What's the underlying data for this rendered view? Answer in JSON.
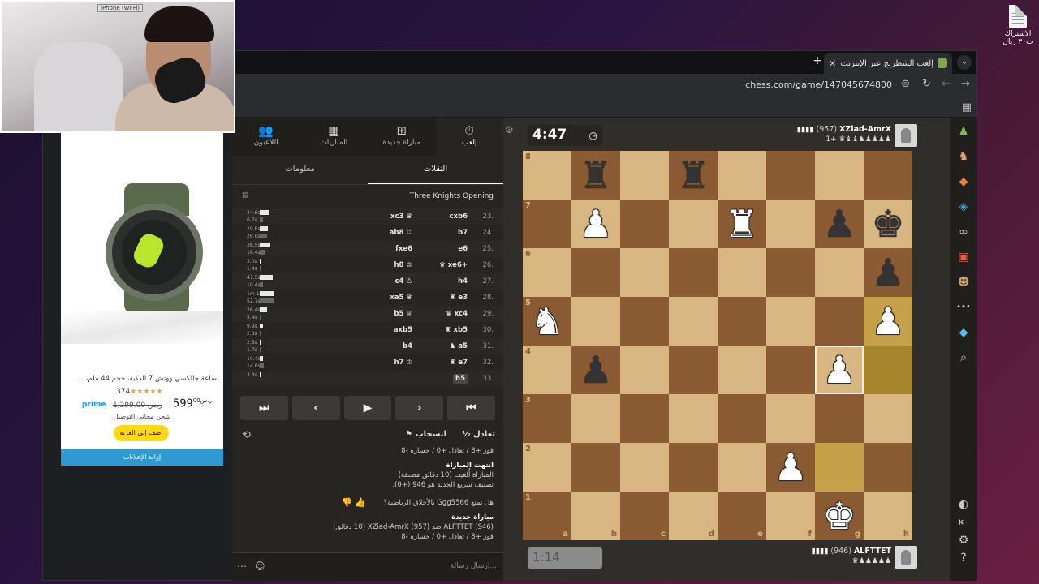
{
  "desktop": {
    "file_label": "الاشتراك ب٣٠ ريال"
  },
  "webcam": {
    "label": "iPhone (Wi-Fi)"
  },
  "browser": {
    "tab_title": "إلعب الشطرنج عبر الإنترنت مجاناً",
    "url": "chess.com/game/147045674800"
  },
  "ad": {
    "title": "ساعة جالكسي ووتش 7 الذكية، حجم 44 ملم، ...",
    "rating_count": "374",
    "stars": "★★★★★",
    "prime": "prime",
    "old_price": "ر.س 1,299.00",
    "price_main": "599",
    "price_frac": "00",
    "price_currency": "ر.س",
    "shipping": "شحن مجاني التوصيل",
    "cart_button": "أضف إلى العربة",
    "remove_ads": "إزالة الإعلانات"
  },
  "panel": {
    "tabs": [
      {
        "label": "إلعب",
        "icon": "⏱"
      },
      {
        "label": "مباراة جديدة",
        "icon": "⊞"
      },
      {
        "label": "المباريات",
        "icon": "▦"
      },
      {
        "label": "اللاعبون",
        "icon": "👥"
      }
    ],
    "subtabs": [
      "النقلات",
      "معلومات"
    ],
    "opening": "Three Knights Opening",
    "moves": [
      {
        "n": "23.",
        "w": "cxb6",
        "b": "xc3 ♛",
        "t1": "34.6s",
        "t2": "6.7s",
        "p1": 12,
        "p2": 4
      },
      {
        "n": "24.",
        "w": "b7",
        "b": "ab8 ♖",
        "t1": "29.8s",
        "t2": "26.6s",
        "p1": 10,
        "p2": 9
      },
      {
        "n": "25.",
        "w": "e6",
        "b": "fxe6",
        "t1": "38.5s",
        "t2": "18.4s",
        "p1": 13,
        "p2": 6
      },
      {
        "n": "26.",
        "w": "♛ xe6+",
        "b": "h8 ♔",
        "t1": "3.0s",
        "t2": "1.4s",
        "p1": 2,
        "p2": 1
      },
      {
        "n": "27.",
        "w": "h4",
        "b": "c4 ♙",
        "t1": "47.5s",
        "t2": "10.4s",
        "p1": 16,
        "p2": 4
      },
      {
        "n": "28.",
        "w": "♜ e3",
        "b": "xa5 ♛",
        "t1": "1m 1s",
        "t2": "52.7s",
        "p1": 18,
        "p2": 17
      },
      {
        "n": "29.",
        "w": "♛ xc4",
        "b": "b5 ♕",
        "t1": "26.4s",
        "t2": "5.4s",
        "p1": 9,
        "p2": 2
      },
      {
        "n": "30.",
        "w": "♜ xb5",
        "b": "axb5",
        "t1": "9.9s",
        "t2": "2.8s",
        "p1": 4,
        "p2": 1
      },
      {
        "n": "31.",
        "w": "♞ a5",
        "b": "b4",
        "t1": "2.8s",
        "t2": "1.7s",
        "p1": 1,
        "p2": 1
      },
      {
        "n": "32.",
        "w": "♜ e7",
        "b": "h7 ♔",
        "t1": "10.4s",
        "t2": "14.6s",
        "p1": 4,
        "p2": 5
      },
      {
        "n": "33.",
        "w": "h5",
        "b": "",
        "t1": "3.8s",
        "t2": "",
        "p1": 1,
        "p2": 0
      }
    ],
    "controls": [
      "⏮",
      "‹",
      "▶",
      "›",
      "⏭"
    ],
    "draw": "½ تعادل",
    "resign": "⚑ انسحاب",
    "flip_icon": "⟲",
    "chat": {
      "line1": "فوز +8 / تعادل +0 / خسارة -8",
      "over_title": "انتهت المباراة",
      "over_line": "المباراة أُلغيت (10 دقائق مصنفة)",
      "rating_line": "تصنيف سريع الجديد هو 946 (+0).",
      "question": "هل تمتع Ggg5566 بالأخلاق الرياضية؟",
      "new_game": "مباراة جديدة",
      "match_line": "ALFTTET (946) ضد XZiad-AmrX (957) (10 دقائق)",
      "line2": "فوز +8 / تعادل +0 / خسارة -8"
    },
    "chat_placeholder": "إرسال رسالة..."
  },
  "game": {
    "top_clock": "4:47",
    "bottom_clock": "1:14",
    "top_player": {
      "name": "XZiad-AmrX",
      "rating": "(957)",
      "captured": "1+ ♛♝♝♞♟♟♟♟"
    },
    "bottom_player": {
      "name": "ALFTTET",
      "rating": "(946)",
      "captured": "♛♟♟♟♟♟"
    },
    "files": [
      "a",
      "b",
      "c",
      "d",
      "e",
      "f",
      "g",
      "h"
    ],
    "ranks": [
      "8",
      "7",
      "6",
      "5",
      "4",
      "3",
      "2",
      "1"
    ],
    "pieces": [
      {
        "sq": "b8",
        "p": "♜",
        "c": "black"
      },
      {
        "sq": "d8",
        "p": "♜",
        "c": "black"
      },
      {
        "sq": "b7",
        "p": "♟",
        "c": "white"
      },
      {
        "sq": "e7",
        "p": "♜",
        "c": "white"
      },
      {
        "sq": "g7",
        "p": "♟",
        "c": "black"
      },
      {
        "sq": "h7",
        "p": "♚",
        "c": "black"
      },
      {
        "sq": "h6",
        "p": "♟",
        "c": "black"
      },
      {
        "sq": "a5",
        "p": "♞",
        "c": "white"
      },
      {
        "sq": "h5",
        "p": "♟",
        "c": "white"
      },
      {
        "sq": "b4",
        "p": "♟",
        "c": "black"
      },
      {
        "sq": "g4",
        "p": "♟",
        "c": "white"
      },
      {
        "sq": "f2",
        "p": "♟",
        "c": "white"
      },
      {
        "sq": "g1",
        "p": "♚",
        "c": "white"
      }
    ],
    "highlights": [
      "h5",
      "h4",
      "g2"
    ],
    "selected": "g4"
  },
  "sidebar_icons": [
    {
      "name": "pawn-icon",
      "glyph": "♟",
      "color": "#81b64c"
    },
    {
      "name": "puzzle-icon",
      "glyph": "♞",
      "color": "#f0a070"
    },
    {
      "name": "learn-icon",
      "glyph": "◆",
      "color": "#f07b3f"
    },
    {
      "name": "watch-icon",
      "glyph": "◈",
      "color": "#3aa3d6"
    },
    {
      "name": "community-icon",
      "glyph": "∞",
      "color": "#d0d0d0"
    },
    {
      "name": "news-icon",
      "glyph": "▣",
      "color": "#e0604d"
    },
    {
      "name": "friends-icon",
      "glyph": "☻",
      "color": "#c8a070"
    },
    {
      "name": "more-icon",
      "glyph": "•••",
      "color": "#d0d0d0"
    },
    {
      "name": "diamond-icon",
      "glyph": "◆",
      "color": "#4fc3f7"
    },
    {
      "name": "search-icon",
      "glyph": "⌕",
      "color": "#d0d0d0"
    }
  ],
  "sidebar_bottom_icons": [
    {
      "name": "theme-icon",
      "glyph": "◐"
    },
    {
      "name": "collapse-icon",
      "glyph": "⇤"
    },
    {
      "name": "settings-icon",
      "glyph": "⚙"
    },
    {
      "name": "help-icon",
      "glyph": "?"
    }
  ]
}
